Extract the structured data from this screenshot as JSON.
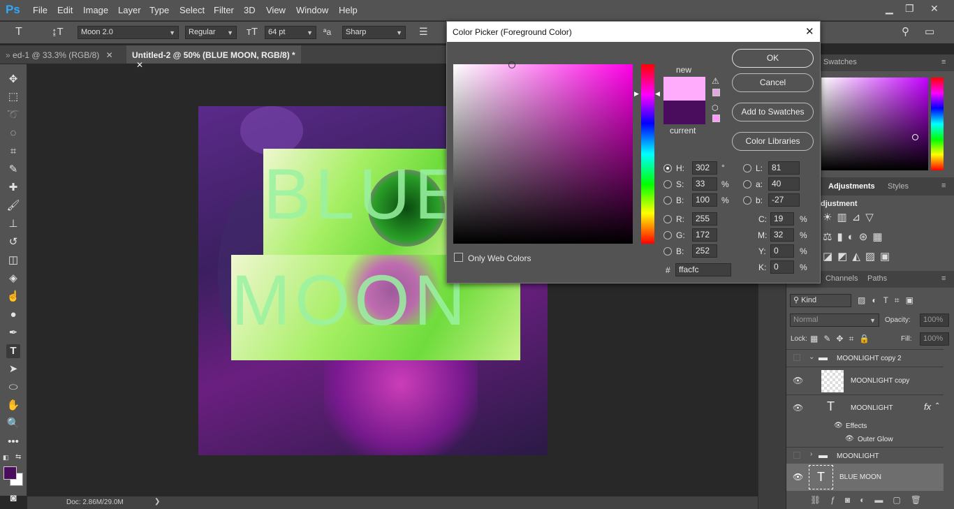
{
  "app": {
    "logo": "Ps"
  },
  "menu": [
    "File",
    "Edit",
    "Image",
    "Layer",
    "Type",
    "Select",
    "Filter",
    "3D",
    "View",
    "Window",
    "Help"
  ],
  "options": {
    "font_family": "Moon 2.0",
    "font_style": "Regular",
    "font_size": "64 pt",
    "antialias": "Sharp"
  },
  "tabs": [
    {
      "label": "ed-1 @ 33.3% (RGB/8)"
    },
    {
      "label": "Untitled-2 @ 50% (BLUE MOON, RGB/8) *"
    }
  ],
  "canvas": {
    "line1": "BLUE",
    "line2": "MOON"
  },
  "status": {
    "doc": "Doc: 2.86M/29.0M"
  },
  "dialog": {
    "title": "Color Picker (Foreground Color)",
    "new_label": "new",
    "current_label": "current",
    "new_color": "#ffacfc",
    "current_color": "#4a0c5c",
    "buttons": {
      "ok": "OK",
      "cancel": "Cancel",
      "add": "Add to Swatches",
      "libraries": "Color Libraries"
    },
    "hsb": {
      "h_label": "H:",
      "h": "302",
      "h_unit": "°",
      "s_label": "S:",
      "s": "33",
      "s_unit": "%",
      "b_label": "B:",
      "b": "100",
      "b_unit": "%"
    },
    "rgb": {
      "r_label": "R:",
      "r": "255",
      "g_label": "G:",
      "g": "172",
      "b_label": "B:",
      "b": "252"
    },
    "lab": {
      "l_label": "L:",
      "l": "81",
      "a_label": "a:",
      "a": "40",
      "b_label": "b:",
      "b": "-27"
    },
    "cmyk": {
      "c_label": "C:",
      "c": "19",
      "m_label": "M:",
      "m": "32",
      "y_label": "Y:",
      "y": "0",
      "k_label": "K:",
      "k": "0",
      "unit": "%"
    },
    "hex_label": "#",
    "hex": "ffacfc",
    "web_only": "Only Web Colors"
  },
  "panels": {
    "swatches_tab": "Swatches",
    "adjustments_tab": "Adjustments",
    "styles_tab": "Styles",
    "adjust_label": "djustment",
    "channels_tab": "Channels",
    "paths_tab": "Paths",
    "kind": "Kind",
    "blend": "Normal",
    "opacity_label": "Opacity:",
    "opacity": "100%",
    "lock_label": "Lock:",
    "fill_label": "Fill:",
    "fill": "100%"
  },
  "layers": [
    {
      "name": "MOONLIGHT copy 2"
    },
    {
      "name": "MOONLIGHT copy"
    },
    {
      "name": "MOONLIGHT"
    },
    {
      "name": "Effects"
    },
    {
      "name": "Outer Glow"
    },
    {
      "name": "MOONLIGHT"
    },
    {
      "name": "BLUE MOON"
    }
  ],
  "colors": {
    "accent": "#31a8ff",
    "foreground": "#4a0c5c",
    "background": "#ffffff"
  }
}
